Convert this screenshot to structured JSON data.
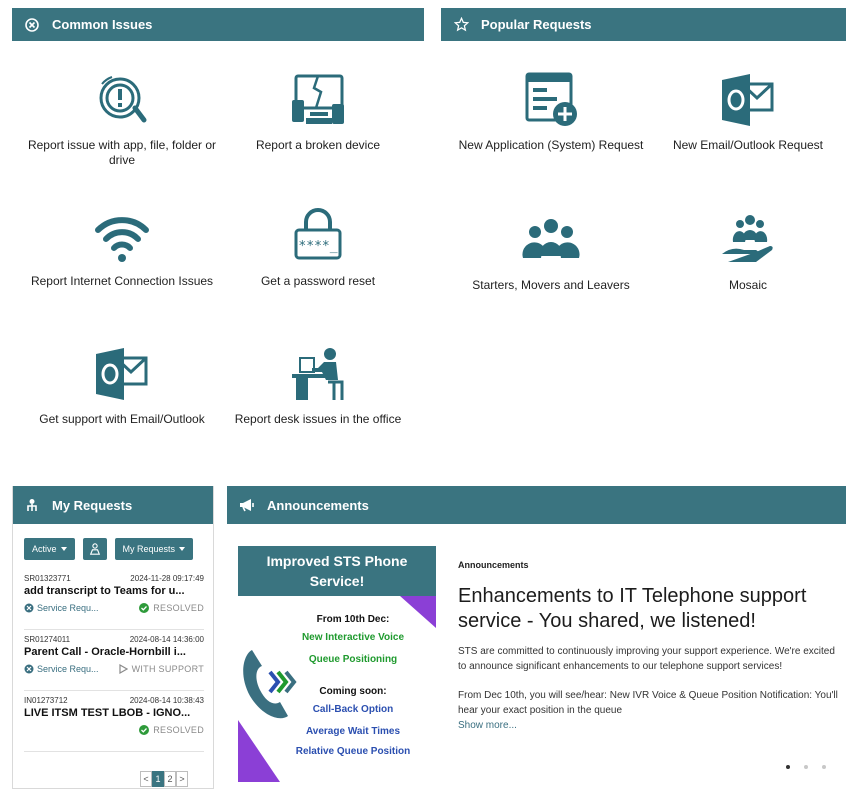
{
  "common_issues": {
    "title": "Common Issues",
    "tiles": [
      {
        "label": "Report issue with app, file, folder or drive",
        "icon": "search-alert-icon"
      },
      {
        "label": "Report a broken device",
        "icon": "broken-device-icon"
      },
      {
        "label": "Report Internet Connection Issues",
        "icon": "wifi-icon"
      },
      {
        "label": "Get a password reset",
        "icon": "lock-password-icon"
      },
      {
        "label": "Get support with Email/Outlook",
        "icon": "outlook-icon"
      },
      {
        "label": "Report desk issues in the office",
        "icon": "desk-worker-icon"
      }
    ]
  },
  "popular_requests": {
    "title": "Popular Requests",
    "tiles": [
      {
        "label": "New Application (System) Request",
        "icon": "new-application-icon"
      },
      {
        "label": "New Email/Outlook Request",
        "icon": "outlook-icon"
      },
      {
        "label": "Starters, Movers and Leavers",
        "icon": "people-group-icon"
      },
      {
        "label": "Mosaic",
        "icon": "hand-people-icon"
      }
    ]
  },
  "my_requests": {
    "title": "My Requests",
    "filters": {
      "status": "Active",
      "scope": "My Requests"
    },
    "items": [
      {
        "id": "SR01323771",
        "date": "2024-11-28 09:17:49",
        "title": "add transcript to Teams for u...",
        "type": "Service Requ...",
        "status": "RESOLVED"
      },
      {
        "id": "SR01274011",
        "date": "2024-08-14 14:36:00",
        "title": "Parent Call - Oracle-Hornbill i...",
        "type": "Service Requ...",
        "status": "WITH SUPPORT"
      },
      {
        "id": "IN01273712",
        "date": "2024-08-14 10:38:43",
        "title": "LIVE ITSM TEST LBOB - IGNO...",
        "type": "",
        "status": "RESOLVED"
      }
    ],
    "pager": {
      "prev": "<",
      "pages": [
        "1",
        "2"
      ],
      "next": ">"
    }
  },
  "announcements": {
    "title": "Announcements",
    "banner": {
      "heading_line1": "Improved STS Phone",
      "heading_line2": "Service!",
      "from_label": "From 10th Dec:",
      "feature1": "New Interactive Voice",
      "feature2": "Queue Positioning",
      "coming_label": "Coming soon:",
      "soon1": "Call-Back Option",
      "soon2": "Average Wait Times",
      "soon3": "Relative Queue Position"
    },
    "item_label": "Announcements",
    "item_title": "Enhancements to IT Telephone support service - You shared, we listened!",
    "item_body1": "STS are committed to continuously improving your support experience. We're excited to announce significant enhancements to our telephone support services!",
    "item_body2": "From Dec 10th, you will see/hear: New IVR Voice & Queue Position Notification: You'll hear your exact position in the queue",
    "show_more": "Show more..."
  },
  "colors": {
    "accent": "#3a7480",
    "banner_purple": "#8b3fd6",
    "banner_green": "#1f9a2e",
    "banner_blue": "#2b4fb0"
  }
}
